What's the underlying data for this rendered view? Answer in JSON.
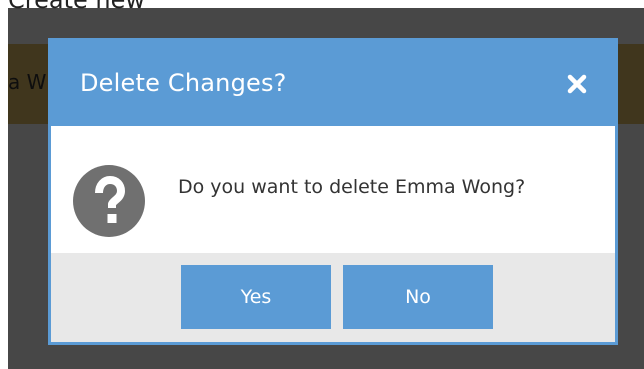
{
  "background": {
    "heading_text": "Create new",
    "strip_text": "a W"
  },
  "dialog": {
    "title": "Delete Changes?",
    "close_icon": "close-icon",
    "question_icon": "question-circle-icon",
    "message": "Do you want to delete Emma Wong?",
    "buttons": {
      "yes_label": "Yes",
      "no_label": "No"
    }
  },
  "colors": {
    "accent": "#5b9bd5",
    "overlay": "#000000",
    "footer": "#e8e8e8",
    "icon": "#707070",
    "highlight_strip": "#e7c06a"
  }
}
